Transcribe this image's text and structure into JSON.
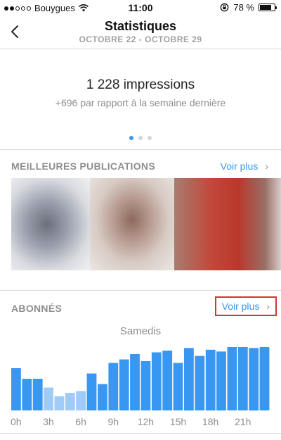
{
  "status_bar": {
    "carrier": "Bouygues",
    "time": "11:00",
    "battery": "78 %",
    "battery_level": 0.78,
    "signal_bars_filled": 2,
    "signal_bars_total": 5,
    "icons": [
      "wifi-icon",
      "rotation-lock-icon",
      "battery-icon"
    ]
  },
  "header": {
    "title": "Statistiques",
    "subtitle": "OCTOBRE 22 - OCTOBRE 29",
    "back_icon": "chevron-left-icon"
  },
  "summary": {
    "value": "1 228 impressions",
    "comparison": "+696 par rapport à la semaine dernière",
    "pager_count": 3,
    "pager_active": 0
  },
  "top_posts": {
    "title": "MEILLEURES PUBLICATIONS",
    "see_more": "Voir plus",
    "see_more_icon": "chevron-right-icon"
  },
  "followers": {
    "title": "ABONNÉS",
    "see_more": "Voir plus",
    "see_more_icon": "chevron-right-icon",
    "highlight_color": "#d03636"
  },
  "colors": {
    "accent": "#3897f0",
    "bar_dark": "#3897f0",
    "bar_light": "#9fcbf7"
  },
  "chart_data": {
    "type": "bar",
    "title": "Samedis",
    "categories": [
      "0h",
      "1h",
      "2h",
      "3h",
      "4h",
      "5h",
      "6h",
      "7h",
      "8h",
      "9h",
      "10h",
      "11h",
      "12h",
      "13h",
      "14h",
      "15h",
      "16h",
      "17h",
      "18h",
      "19h",
      "20h",
      "21h",
      "22h",
      "23h"
    ],
    "tick_labels": [
      "0h",
      "3h",
      "6h",
      "9h",
      "12h",
      "15h",
      "18h",
      "21h"
    ],
    "values": [
      48,
      36,
      36,
      26,
      16,
      20,
      22,
      42,
      30,
      54,
      58,
      64,
      56,
      66,
      68,
      54,
      71,
      62,
      69,
      67,
      72,
      72,
      71,
      72
    ],
    "ylim": [
      0,
      80
    ],
    "grid": false,
    "legend": "none"
  }
}
